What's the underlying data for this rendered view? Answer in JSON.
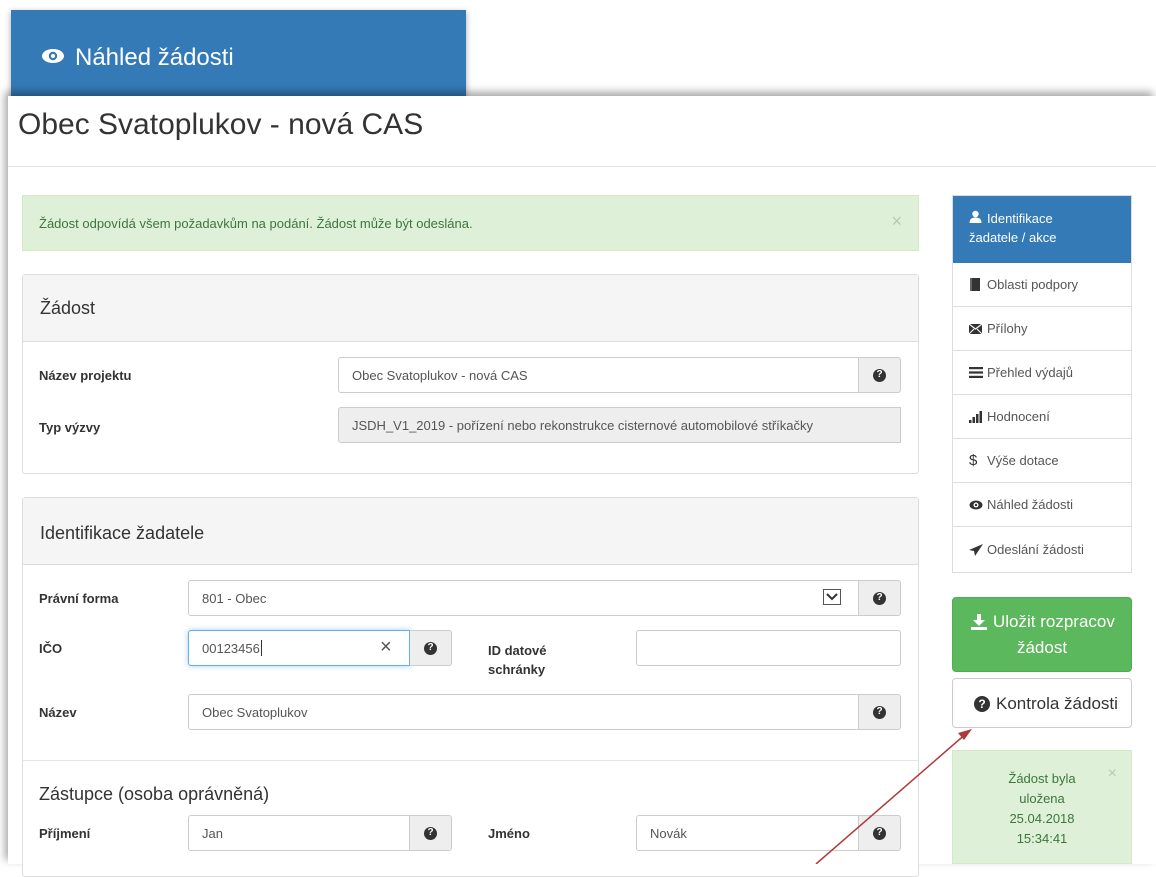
{
  "header": {
    "tab_label": "Náhled žádosti"
  },
  "page": {
    "title": "Obec Svatoplukov - nová CAS"
  },
  "alert": {
    "message": "Žádost odpovídá všem požadavkům na podání. Žádost může být odeslána.",
    "close": "×"
  },
  "zadost": {
    "heading": "Žádost",
    "nazev_projektu_label": "Název projektu",
    "nazev_projektu_value": "Obec Svatoplukov - nová CAS",
    "typ_vyzvy_label": "Typ výzvy",
    "typ_vyzvy_value": "JSDH_V1_2019 - pořízení nebo rekonstrukce cisternové automobilové stříkačky"
  },
  "zadatel": {
    "heading": "Identifikace žadatele",
    "pravni_forma_label": "Právní forma",
    "pravni_forma_value": "801 - Obec",
    "ico_label": "IČO",
    "ico_value": "00123456",
    "clear": "×",
    "id_schranky_label_1": "ID datové",
    "id_schranky_label_2": "schránky",
    "id_schranky_value": "",
    "nazev_label": "Název",
    "nazev_value": "Obec Svatoplukov"
  },
  "zastupce": {
    "heading": "Zástupce (osoba oprávněná)",
    "prijmeni_label": "Příjmení",
    "prijmeni_value": "Jan",
    "jmeno_label": "Jméno",
    "jmeno_value": "Novák"
  },
  "sidebar": {
    "items": [
      {
        "label_1": "Identifikace",
        "label_2": "žadatele / akce",
        "icon": "user-icon"
      },
      {
        "label": "Oblasti podpory",
        "icon": "book-icon"
      },
      {
        "label": "Přílohy",
        "icon": "envelope-icon"
      },
      {
        "label": "Přehled výdajů",
        "icon": "list-icon"
      },
      {
        "label": "Hodnocení",
        "icon": "signal-icon"
      },
      {
        "label": "Výše dotace",
        "icon": "dollar-icon"
      },
      {
        "label": "Náhled žádosti",
        "icon": "eye-icon"
      },
      {
        "label": "Odeslání žádosti",
        "icon": "send-icon"
      }
    ]
  },
  "actions": {
    "save_line1": "Uložit rozpracov",
    "save_line2": "žádost",
    "check": "Kontrola žádosti"
  },
  "saved_notice": {
    "line1": "Žádost byla",
    "line2": "uložena",
    "line3": "25.04.2018",
    "line4": "15:34:41",
    "close": "×"
  },
  "colors": {
    "primary": "#337ab7",
    "success": "#5cb85c",
    "alert_bg": "#dff0d8",
    "alert_text": "#3c763d",
    "arrow": "#b03a3a"
  }
}
